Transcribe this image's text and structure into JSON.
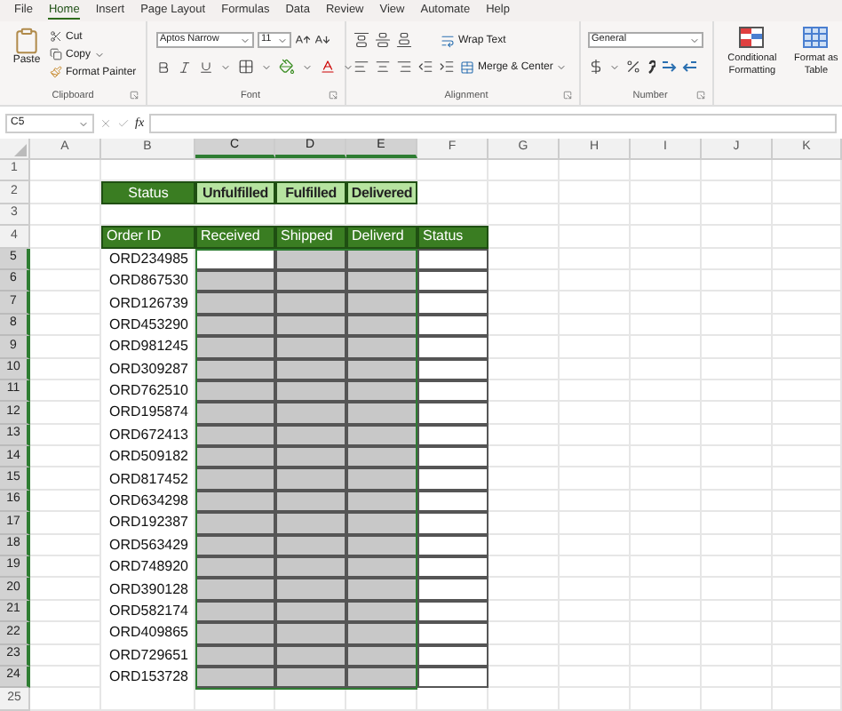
{
  "ribbon_tabs": [
    {
      "label": "File",
      "selected": false
    },
    {
      "label": "Home",
      "selected": true
    },
    {
      "label": "Insert",
      "selected": false
    },
    {
      "label": "Page Layout",
      "selected": false
    },
    {
      "label": "Formulas",
      "selected": false
    },
    {
      "label": "Data",
      "selected": false
    },
    {
      "label": "Review",
      "selected": false
    },
    {
      "label": "View",
      "selected": false
    },
    {
      "label": "Automate",
      "selected": false
    },
    {
      "label": "Help",
      "selected": false
    }
  ],
  "clipboard": {
    "paste": "Paste",
    "cut": "Cut",
    "copy": "Copy",
    "format_painter": "Format Painter",
    "label": "Clipboard"
  },
  "font": {
    "name": "Aptos Narrow",
    "size": "11",
    "label": "Font"
  },
  "alignment": {
    "wrap_text": "Wrap Text",
    "merge_center": "Merge & Center",
    "label": "Alignment"
  },
  "number": {
    "format": "General",
    "label": "Number"
  },
  "styles": {
    "conditional_formatting": "Conditional Formatting",
    "format_as_table": "Format as Table"
  },
  "formula_bar": {
    "name_box": "C5",
    "fx": "fx"
  },
  "columns": [
    {
      "label": "A",
      "selected": false
    },
    {
      "label": "B",
      "selected": false
    },
    {
      "label": "C",
      "selected": true
    },
    {
      "label": "D",
      "selected": true
    },
    {
      "label": "E",
      "selected": true
    },
    {
      "label": "F",
      "selected": false
    },
    {
      "label": "G",
      "selected": false
    },
    {
      "label": "H",
      "selected": false
    },
    {
      "label": "I",
      "selected": false
    },
    {
      "label": "J",
      "selected": false
    },
    {
      "label": "K",
      "selected": false
    }
  ],
  "rows": [
    {
      "number": "1",
      "selected": false
    },
    {
      "number": "2",
      "selected": false,
      "cells": [
        {
          "kind": "blank"
        },
        {
          "kind": "title",
          "text": "Status"
        },
        {
          "kind": "chip",
          "text": "Unfulfilled"
        },
        {
          "kind": "chip",
          "text": "Fulfilled"
        },
        {
          "kind": "chip",
          "text": "Delivered"
        }
      ]
    },
    {
      "number": "3",
      "selected": false
    },
    {
      "number": "4",
      "selected": false,
      "cells": [
        {
          "kind": "blank"
        },
        {
          "kind": "header",
          "text": "Order ID"
        },
        {
          "kind": "header",
          "text": "Received"
        },
        {
          "kind": "header",
          "text": "Shipped"
        },
        {
          "kind": "header",
          "text": "Deliverd"
        },
        {
          "kind": "header",
          "text": "Status"
        }
      ]
    },
    {
      "number": "5",
      "selected": true,
      "cells": [
        {
          "kind": "blank"
        },
        {
          "kind": "id",
          "text": "ORD234985"
        },
        {
          "kind": "active"
        },
        {
          "kind": "gray"
        },
        {
          "kind": "gray"
        },
        {
          "kind": "box"
        }
      ]
    },
    {
      "number": "6",
      "selected": true,
      "cells": [
        {
          "kind": "blank"
        },
        {
          "kind": "id",
          "text": "ORD867530"
        },
        {
          "kind": "gray"
        },
        {
          "kind": "gray"
        },
        {
          "kind": "gray"
        },
        {
          "kind": "box"
        }
      ]
    },
    {
      "number": "7",
      "selected": true,
      "cells": [
        {
          "kind": "blank"
        },
        {
          "kind": "id",
          "text": "ORD126739"
        },
        {
          "kind": "gray"
        },
        {
          "kind": "gray"
        },
        {
          "kind": "gray"
        },
        {
          "kind": "box"
        }
      ]
    },
    {
      "number": "8",
      "selected": true,
      "cells": [
        {
          "kind": "blank"
        },
        {
          "kind": "id",
          "text": "ORD453290"
        },
        {
          "kind": "gray"
        },
        {
          "kind": "gray"
        },
        {
          "kind": "gray"
        },
        {
          "kind": "box"
        }
      ]
    },
    {
      "number": "9",
      "selected": true,
      "cells": [
        {
          "kind": "blank"
        },
        {
          "kind": "id",
          "text": "ORD981245"
        },
        {
          "kind": "gray"
        },
        {
          "kind": "gray"
        },
        {
          "kind": "gray"
        },
        {
          "kind": "box"
        }
      ]
    },
    {
      "number": "10",
      "selected": true,
      "cells": [
        {
          "kind": "blank"
        },
        {
          "kind": "id",
          "text": "ORD309287"
        },
        {
          "kind": "gray"
        },
        {
          "kind": "gray"
        },
        {
          "kind": "gray"
        },
        {
          "kind": "box"
        }
      ]
    },
    {
      "number": "11",
      "selected": true,
      "cells": [
        {
          "kind": "blank"
        },
        {
          "kind": "id",
          "text": "ORD762510"
        },
        {
          "kind": "gray"
        },
        {
          "kind": "gray"
        },
        {
          "kind": "gray"
        },
        {
          "kind": "box"
        }
      ]
    },
    {
      "number": "12",
      "selected": true,
      "cells": [
        {
          "kind": "blank"
        },
        {
          "kind": "id",
          "text": "ORD195874"
        },
        {
          "kind": "gray"
        },
        {
          "kind": "gray"
        },
        {
          "kind": "gray"
        },
        {
          "kind": "box"
        }
      ]
    },
    {
      "number": "13",
      "selected": true,
      "cells": [
        {
          "kind": "blank"
        },
        {
          "kind": "id",
          "text": "ORD672413"
        },
        {
          "kind": "gray"
        },
        {
          "kind": "gray"
        },
        {
          "kind": "gray"
        },
        {
          "kind": "box"
        }
      ]
    },
    {
      "number": "14",
      "selected": true,
      "cells": [
        {
          "kind": "blank"
        },
        {
          "kind": "id",
          "text": "ORD509182"
        },
        {
          "kind": "gray"
        },
        {
          "kind": "gray"
        },
        {
          "kind": "gray"
        },
        {
          "kind": "box"
        }
      ]
    },
    {
      "number": "15",
      "selected": true,
      "cells": [
        {
          "kind": "blank"
        },
        {
          "kind": "id",
          "text": "ORD817452"
        },
        {
          "kind": "gray"
        },
        {
          "kind": "gray"
        },
        {
          "kind": "gray"
        },
        {
          "kind": "box"
        }
      ]
    },
    {
      "number": "16",
      "selected": true,
      "cells": [
        {
          "kind": "blank"
        },
        {
          "kind": "id",
          "text": "ORD634298"
        },
        {
          "kind": "gray"
        },
        {
          "kind": "gray"
        },
        {
          "kind": "gray"
        },
        {
          "kind": "box"
        }
      ]
    },
    {
      "number": "17",
      "selected": true,
      "cells": [
        {
          "kind": "blank"
        },
        {
          "kind": "id",
          "text": "ORD192387"
        },
        {
          "kind": "gray"
        },
        {
          "kind": "gray"
        },
        {
          "kind": "gray"
        },
        {
          "kind": "box"
        }
      ]
    },
    {
      "number": "18",
      "selected": true,
      "cells": [
        {
          "kind": "blank"
        },
        {
          "kind": "id",
          "text": "ORD563429"
        },
        {
          "kind": "gray"
        },
        {
          "kind": "gray"
        },
        {
          "kind": "gray"
        },
        {
          "kind": "box"
        }
      ]
    },
    {
      "number": "19",
      "selected": true,
      "cells": [
        {
          "kind": "blank"
        },
        {
          "kind": "id",
          "text": "ORD748920"
        },
        {
          "kind": "gray"
        },
        {
          "kind": "gray"
        },
        {
          "kind": "gray"
        },
        {
          "kind": "box"
        }
      ]
    },
    {
      "number": "20",
      "selected": true,
      "cells": [
        {
          "kind": "blank"
        },
        {
          "kind": "id",
          "text": "ORD390128"
        },
        {
          "kind": "gray"
        },
        {
          "kind": "gray"
        },
        {
          "kind": "gray"
        },
        {
          "kind": "box"
        }
      ]
    },
    {
      "number": "21",
      "selected": true,
      "cells": [
        {
          "kind": "blank"
        },
        {
          "kind": "id",
          "text": "ORD582174"
        },
        {
          "kind": "gray"
        },
        {
          "kind": "gray"
        },
        {
          "kind": "gray"
        },
        {
          "kind": "box"
        }
      ]
    },
    {
      "number": "22",
      "selected": true,
      "cells": [
        {
          "kind": "blank"
        },
        {
          "kind": "id",
          "text": "ORD409865"
        },
        {
          "kind": "gray"
        },
        {
          "kind": "gray"
        },
        {
          "kind": "gray"
        },
        {
          "kind": "box"
        }
      ]
    },
    {
      "number": "23",
      "selected": true,
      "cells": [
        {
          "kind": "blank"
        },
        {
          "kind": "id",
          "text": "ORD729651"
        },
        {
          "kind": "gray"
        },
        {
          "kind": "gray"
        },
        {
          "kind": "gray"
        },
        {
          "kind": "box"
        }
      ]
    },
    {
      "number": "24",
      "selected": true,
      "cells": [
        {
          "kind": "blank"
        },
        {
          "kind": "id",
          "text": "ORD153728"
        },
        {
          "kind": "gray"
        },
        {
          "kind": "gray"
        },
        {
          "kind": "gray"
        },
        {
          "kind": "box"
        }
      ]
    },
    {
      "number": "25",
      "selected": false
    }
  ]
}
